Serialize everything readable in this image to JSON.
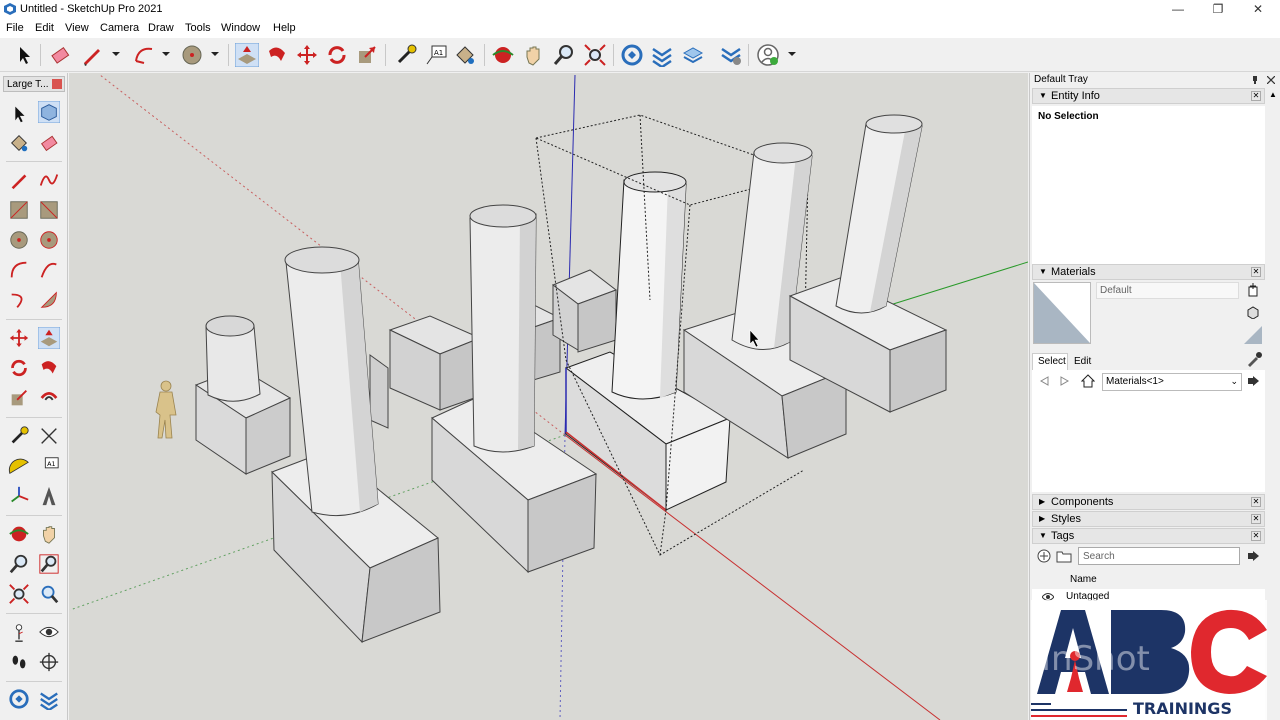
{
  "window": {
    "title": "Untitled - SketchUp Pro 2021"
  },
  "menu": [
    "File",
    "Edit",
    "View",
    "Camera",
    "Draw",
    "Tools",
    "Window",
    "Help"
  ],
  "left_tray": {
    "title": "Large T..."
  },
  "right_tray": {
    "title": "Default Tray",
    "entity_info": {
      "label": "Entity Info",
      "status": "No Selection"
    },
    "materials": {
      "label": "Materials",
      "material_name": "Default",
      "tabs": [
        "Select",
        "Edit"
      ],
      "collection": "Materials<1>"
    },
    "components": {
      "label": "Components"
    },
    "styles": {
      "label": "Styles"
    },
    "tags": {
      "label": "Tags",
      "search_placeholder": "Search",
      "column_name": "Name",
      "rows": [
        "Untagged"
      ]
    }
  },
  "watermark": {
    "brand": "ABC",
    "sub": "TRAININGS",
    "overlay": "InShot"
  },
  "colors": {
    "accent": "#1d3466",
    "brand_red": "#e0282e",
    "viewport_bg": "#d9d9d5"
  }
}
